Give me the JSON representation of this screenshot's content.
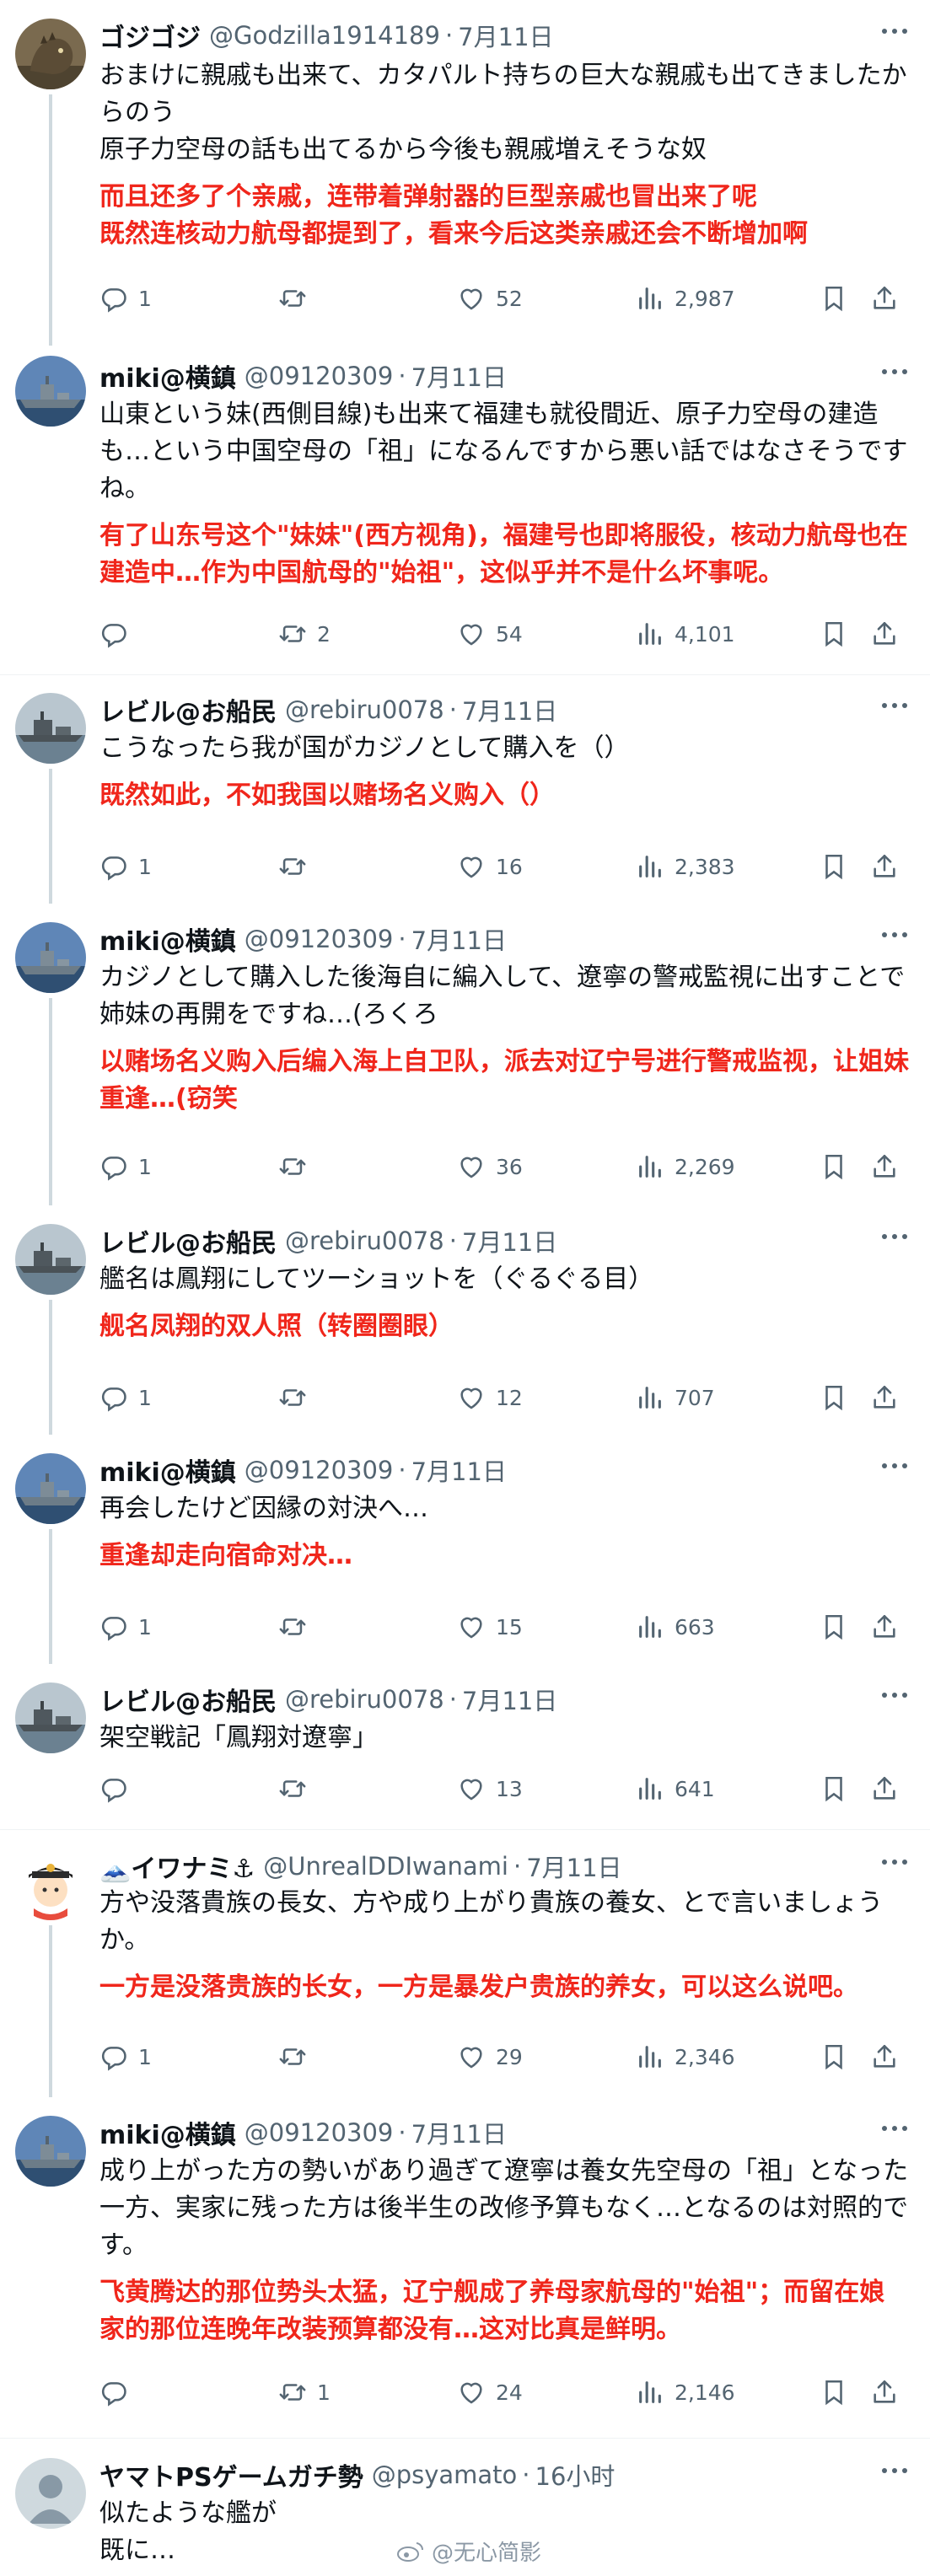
{
  "tweets": [
    {
      "name": "ゴジゴジ",
      "handle": "@Godzilla1914189",
      "date": "7月11日",
      "text_jp": "おまけに親戚も出来て、カタパルト持ちの巨大な親戚も出てきましたからのう\n原子力空母の話も出てるから今後も親戚増えそうな奴",
      "text_cn": "而且还多了个亲戚，连带着弹射器的巨型亲戚也冒出来了呢\n既然连核动力航母都提到了，看来今后这类亲戚还会不断增加啊",
      "reply": "1",
      "retweet": "",
      "like": "52",
      "views": "2,987"
    },
    {
      "name": "miki@横鎮",
      "handle": "@09120309",
      "date": "7月11日",
      "text_jp": "山東という妹(西側目線)も出来て福建も就役間近、原子力空母の建造も…という中国空母の「祖」になるんですから悪い話ではなさそうですね。",
      "text_cn": "有了山东号这个\"妹妹\"(西方视角)，福建号也即将服役，核动力航母也在建造中…作为中国航母的\"始祖\"，这似乎并不是什么坏事呢。",
      "reply": "",
      "retweet": "2",
      "like": "54",
      "views": "4,101"
    },
    {
      "name": "レビル@お船民",
      "handle": "@rebiru0078",
      "date": "7月11日",
      "text_jp": "こうなったら我が国がカジノとして購入を（）",
      "text_cn": "既然如此，不如我国以赌场名义购入（）",
      "reply": "1",
      "retweet": "",
      "like": "16",
      "views": "2,383"
    },
    {
      "name": "miki@横鎮",
      "handle": "@09120309",
      "date": "7月11日",
      "text_jp": "カジノとして購入した後海自に編入して、遼寧の警戒監視に出すことで姉妹の再開をですね…(ろくろ",
      "text_cn": "以赌场名义购入后编入海上自卫队，派去对辽宁号进行警戒监视，让姐妹重逢…(窃笑",
      "reply": "1",
      "retweet": "",
      "like": "36",
      "views": "2,269"
    },
    {
      "name": "レビル@お船民",
      "handle": "@rebiru0078",
      "date": "7月11日",
      "text_jp": "艦名は鳳翔にしてツーショットを（ぐるぐる目）",
      "text_cn": "舰名凤翔的双人照（转圈圈眼）",
      "reply": "1",
      "retweet": "",
      "like": "12",
      "views": "707"
    },
    {
      "name": "miki@横鎮",
      "handle": "@09120309",
      "date": "7月11日",
      "text_jp": "再会したけど因縁の対決へ…",
      "text_cn": "重逢却走向宿命对决…",
      "reply": "1",
      "retweet": "",
      "like": "15",
      "views": "663"
    },
    {
      "name": "レビル@お船民",
      "handle": "@rebiru0078",
      "date": "7月11日",
      "text_jp": "架空戦記「鳳翔対遼寧」",
      "text_cn": "",
      "reply": "",
      "retweet": "",
      "like": "13",
      "views": "641"
    },
    {
      "name": "🗻イワナミ⚓",
      "handle": "@UnrealDDIwanami",
      "date": "7月11日",
      "text_jp": "方や没落貴族の長女、方や成り上がり貴族の養女、とで言いましょうか。",
      "text_cn": "一方是没落贵族的长女，一方是暴发户贵族的养女，可以这么说吧。",
      "reply": "1",
      "retweet": "",
      "like": "29",
      "views": "2,346"
    },
    {
      "name": "miki@横鎮",
      "handle": "@09120309",
      "date": "7月11日",
      "text_jp": "成り上がった方の勢いがあり過ぎて遼寧は養女先空母の「祖」となった一方、実家に残った方は後半生の改修予算もなく…となるのは対照的です。",
      "text_cn": "飞黄腾达的那位势头太猛，辽宁舰成了养母家航母的\"始祖\"；而留在娘家的那位连晚年改装预算都没有…这对比真是鲜明。",
      "reply": "",
      "retweet": "1",
      "like": "24",
      "views": "2,146"
    },
    {
      "name": "ヤマトPSゲームガチ勢",
      "handle": "@psyamato",
      "date": "16小时",
      "text_jp": "似たような艦が\n既に…",
      "text_cn": "",
      "reply": "",
      "retweet": "",
      "like": "",
      "views": ""
    }
  ],
  "watermark": "@无心简影",
  "icons": {
    "reply": "reply-icon",
    "retweet": "retweet-icon",
    "like": "like-icon",
    "views": "views-icon",
    "bookmark": "bookmark-icon",
    "share": "share-icon",
    "more": "more-icon"
  },
  "colors": {
    "translation_red": "#f0261b",
    "secondary_text": "#536471",
    "thread_line": "#cfd9de"
  }
}
